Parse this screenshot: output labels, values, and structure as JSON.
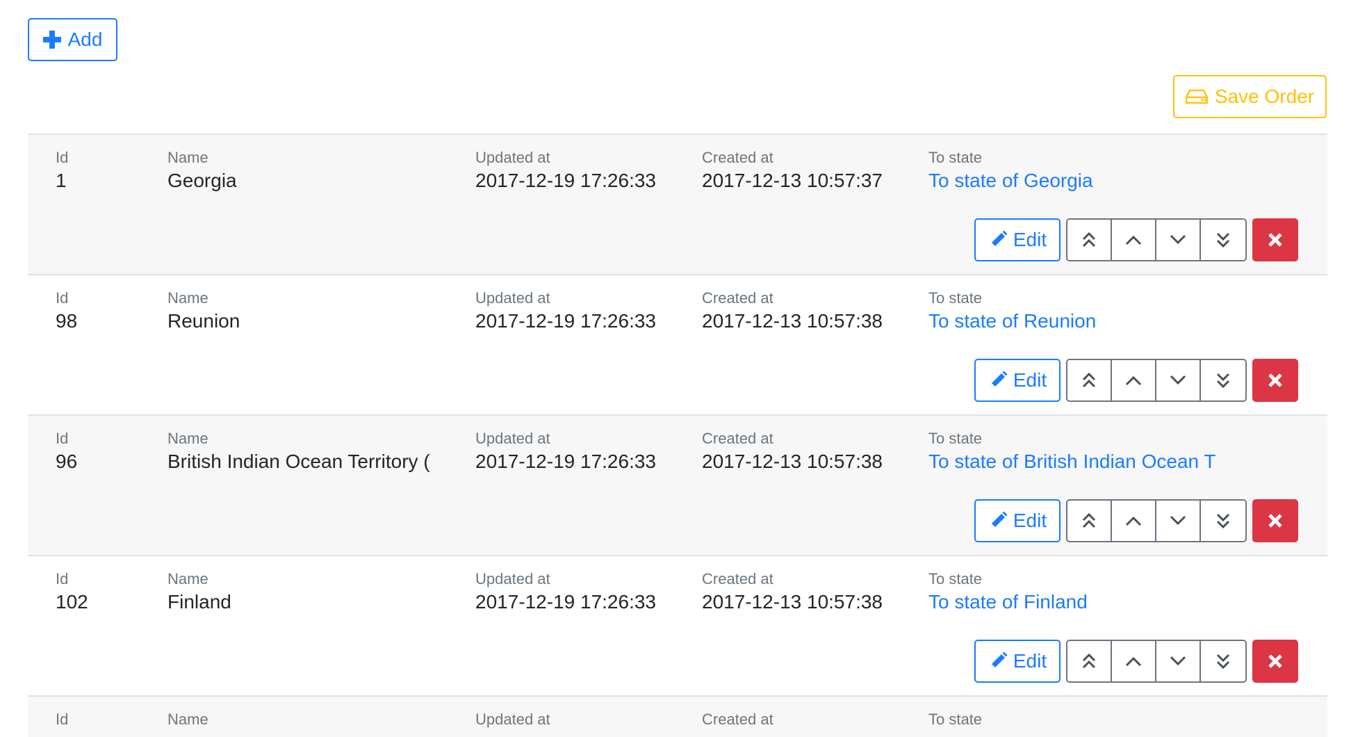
{
  "toolbar": {
    "add_label": "Add",
    "save_order_label": "Save Order"
  },
  "columns": {
    "id": "Id",
    "name": "Name",
    "updated_at": "Updated at",
    "created_at": "Created at",
    "to_state": "To state"
  },
  "rows": [
    {
      "id": "1",
      "name": "Georgia",
      "updated_at": "2017-12-19 17:26:33",
      "created_at": "2017-12-13 10:57:37",
      "to_state": "To state of Georgia",
      "edit_label": "Edit"
    },
    {
      "id": "98",
      "name": "Reunion",
      "updated_at": "2017-12-19 17:26:33",
      "created_at": "2017-12-13 10:57:38",
      "to_state": "To state of Reunion",
      "edit_label": "Edit"
    },
    {
      "id": "96",
      "name": "British Indian Ocean Territory (",
      "updated_at": "2017-12-19 17:26:33",
      "created_at": "2017-12-13 10:57:38",
      "to_state": "To state of British Indian Ocean T",
      "edit_label": "Edit"
    },
    {
      "id": "102",
      "name": "Finland",
      "updated_at": "2017-12-19 17:26:33",
      "created_at": "2017-12-13 10:57:38",
      "to_state": "To state of Finland",
      "edit_label": "Edit"
    }
  ],
  "colors": {
    "primary": "#1a7bff",
    "warning": "#ffc107",
    "danger": "#dc3545",
    "secondary": "#6c757d"
  },
  "icons": {
    "add": "plus-icon",
    "save_order": "hdd-icon",
    "edit": "pencil-icon",
    "move_top": "double-chevron-up-icon",
    "move_up": "chevron-up-icon",
    "move_down": "chevron-down-icon",
    "move_bottom": "double-chevron-down-icon",
    "delete": "close-icon"
  }
}
